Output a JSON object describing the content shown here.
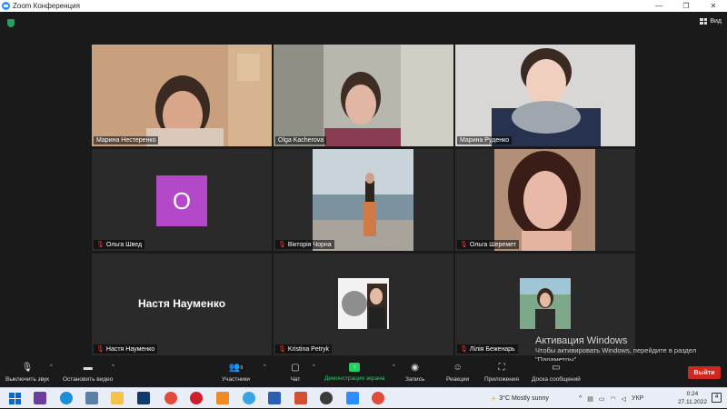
{
  "window": {
    "title": "Zoom Конференция",
    "controls": [
      "—",
      "❐",
      "✕"
    ]
  },
  "header": {
    "view_label": "Вид"
  },
  "participants": [
    {
      "name": "Марина Нестеренко",
      "muted": false,
      "active": true
    },
    {
      "name": "Olga Kacherova",
      "muted": false,
      "active": false
    },
    {
      "name": "Марина Руденко",
      "muted": false,
      "active": false
    },
    {
      "name": "Ольга Швед",
      "muted": true,
      "avatar_letter": "О",
      "avatar_color": "#b349c9"
    },
    {
      "name": "Вікторія Чорна",
      "muted": true
    },
    {
      "name": "Ольга Шеремет",
      "muted": true
    },
    {
      "name": "Настя Науменко",
      "muted": true,
      "display_name": "Настя Науменко"
    },
    {
      "name": "Kristina Petryk",
      "muted": true
    },
    {
      "name": "Лілія Беженарь",
      "muted": true
    }
  ],
  "watermark": {
    "title": "Активация Windows",
    "text": "Чтобы активировать Windows, перейдите в раздел \"Параметры\"."
  },
  "toolbar": {
    "mute_label": "Выключить звук",
    "video_label": "Остановить видео",
    "participants_label": "Участники",
    "participants_count": "9",
    "chat_label": "Чат",
    "share_label": "Демонстрация экрана",
    "record_label": "Запись",
    "reactions_label": "Реакции",
    "apps_label": "Приложения",
    "whiteboard_label": "Доска сообщений",
    "leave_label": "Выйти"
  },
  "taskbar": {
    "weather": "3°C  Mostly sunny",
    "language": "УКР",
    "time": "0:24",
    "date": "27.11.2022",
    "notifications": "4"
  },
  "colors": {
    "accent_green": "#23d160",
    "leave_red": "#d0281e",
    "active_border": "#d8e35a",
    "zoom_blue": "#2d8cff"
  }
}
